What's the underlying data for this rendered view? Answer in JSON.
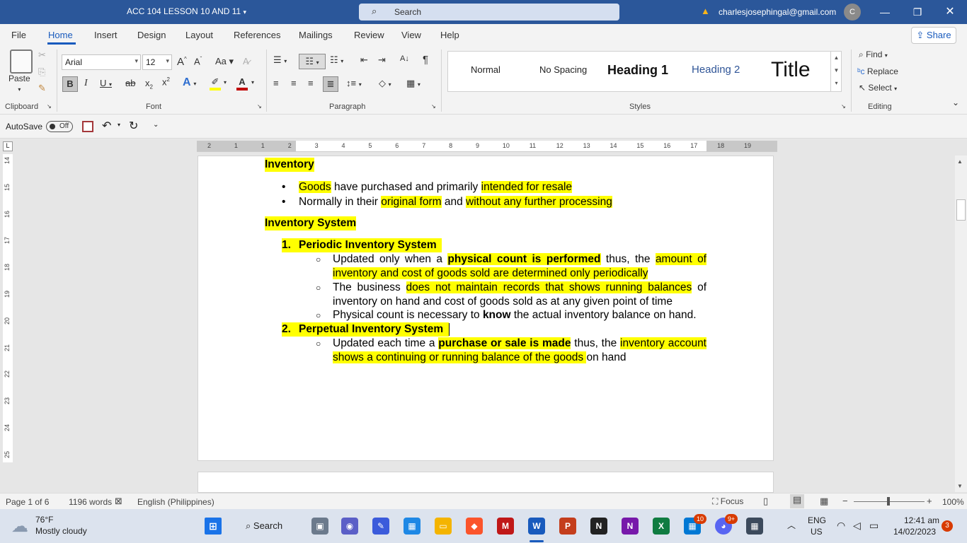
{
  "titlebar": {
    "doc_title": "ACC 104 LESSON 10 AND 11",
    "search_placeholder": "Search",
    "email": "charlesjosephingal@gmail.com",
    "avatar_initial": "C"
  },
  "menu_tabs": [
    "File",
    "Home",
    "Insert",
    "Design",
    "Layout",
    "References",
    "Mailings",
    "Review",
    "View",
    "Help"
  ],
  "share_label": "Share",
  "ribbon": {
    "clipboard": {
      "paste_label": "Paste",
      "group_label": "Clipboard"
    },
    "font": {
      "name": "Arial",
      "size": "12",
      "group_label": "Font"
    },
    "paragraph": {
      "group_label": "Paragraph"
    },
    "styles": {
      "group_label": "Styles",
      "items": [
        "Normal",
        "No Spacing",
        "Heading 1",
        "Heading 2",
        "Title"
      ]
    },
    "editing": {
      "find": "Find",
      "replace": "Replace",
      "select": "Select",
      "group_label": "Editing"
    }
  },
  "qat": {
    "autosave_label": "AutoSave",
    "autosave_state": "Off"
  },
  "ruler": {
    "h_ticks": [
      "2",
      "1",
      "1",
      "2",
      "3",
      "4",
      "5",
      "6",
      "7",
      "8",
      "9",
      "10",
      "11",
      "12",
      "13",
      "14",
      "15",
      "16",
      "17",
      "18",
      "19"
    ],
    "v_ticks": [
      "14",
      "15",
      "16",
      "17",
      "18",
      "19",
      "20",
      "21",
      "22",
      "23",
      "24",
      "25"
    ]
  },
  "document": {
    "heading_inventory": "Inventory",
    "inv_b1": {
      "p1": "Goods",
      "p2": " have purchased and primarily ",
      "p3": "intended for resale"
    },
    "inv_b2": {
      "p1": "Normally in their ",
      "p2": "original form",
      "p3": " and ",
      "p4": "without any further processing"
    },
    "heading_system": "Inventory System",
    "periodic": {
      "num": "1.",
      "title": "Periodic Inventory System",
      "s1": {
        "p1": "Updated only when a ",
        "p2": "physical count is performed",
        "p3": " thus, the ",
        "p4": "amount of inventory and cost of goods sold are determined only periodically"
      },
      "s2": {
        "p1": "The business ",
        "p2": "does not maintain records that shows running balances",
        "p3": " of inventory on hand and cost of goods sold as at any given point of time"
      },
      "s3": {
        "p1": "Physical count is necessary to ",
        "p2": "know",
        "p3": " the actual inventory balance on hand."
      }
    },
    "perpetual": {
      "num": "2.",
      "title": "Perpetual Inventory System",
      "s1": {
        "p1": "Updated each time a ",
        "p2": "purchase or sale is made",
        "p3": " thus, the ",
        "p4": "inventory account shows a continuing or running balance of the goods ",
        "p5": "on hand"
      }
    }
  },
  "statusbar": {
    "page": "Page 1 of 6",
    "words": "1196 words",
    "language": "English (Philippines)",
    "focus": "Focus",
    "zoom": "100%"
  },
  "taskbar": {
    "temp": "76°F",
    "weather": "Mostly cloudy",
    "search_label": "Search",
    "lang_top": "ENG",
    "lang_bottom": "US",
    "time": "12:41 am",
    "date": "14/02/2023",
    "notif_count": "3",
    "teams_badge": "10",
    "discord_badge": "9+"
  }
}
